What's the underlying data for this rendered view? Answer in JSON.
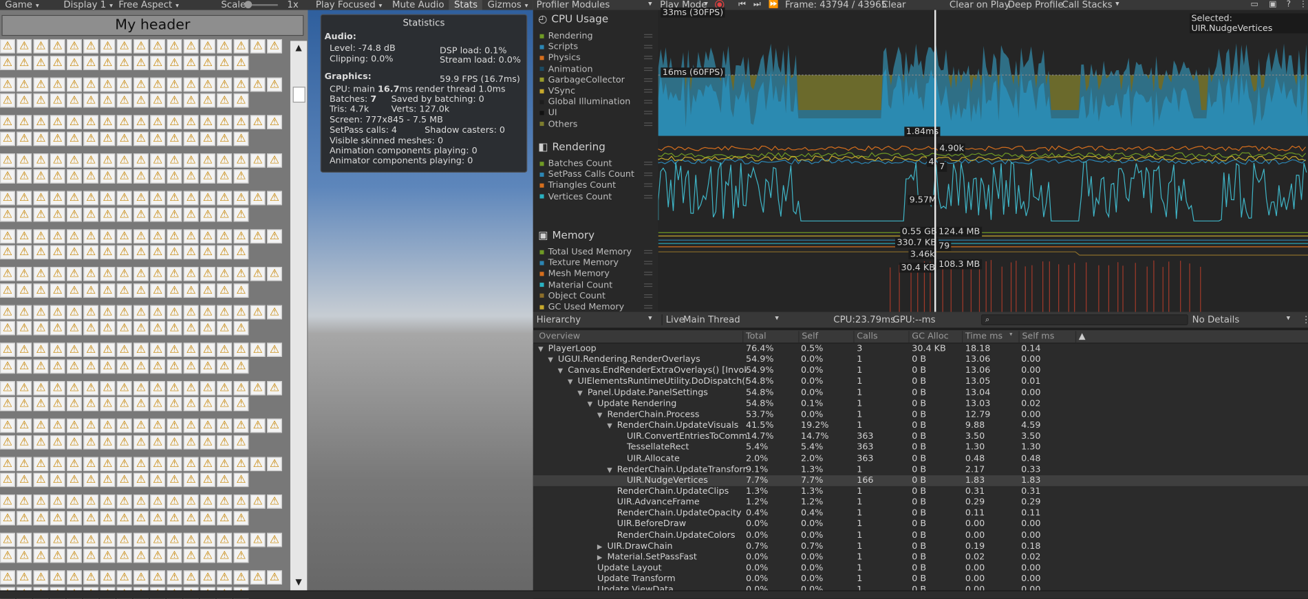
{
  "game_toolbar": {
    "tab": "Game",
    "display": "Display 1",
    "aspect": "Free Aspect",
    "scale_label": "Scale",
    "scale_value": "1x",
    "play_focused": "Play Focused",
    "mute": "Mute Audio",
    "stats": "Stats",
    "gizmos": "Gizmos"
  },
  "game_view": {
    "header": "My header"
  },
  "stats": {
    "title": "Statistics",
    "audio": "Audio:",
    "level": "Level: -74.8 dB",
    "clipping": "Clipping: 0.0%",
    "dsp": "DSP load: 0.1%",
    "stream": "Stream load: 0.0%",
    "graphics": "Graphics:",
    "fps": "59.9 FPS (16.7ms)",
    "cpu_prefix": "CPU: main ",
    "cpu_main": "16.7",
    "cpu_suffix": "ms  render thread 1.0ms",
    "batches_prefix": "Batches: ",
    "batches": "7",
    "saved": "Saved by batching: 0",
    "tris": "Tris: 4.7k",
    "verts": "Verts: 127.0k",
    "screen": "Screen: 777x845 - 7.5 MB",
    "setpass": "SetPass calls: 4",
    "shadow": "Shadow casters: 0",
    "skinned": "Visible skinned meshes: 0",
    "animation": "Animation components playing: 0",
    "animator": "Animator components playing: 0"
  },
  "profiler_toolbar": {
    "modules": "Profiler Modules",
    "play_mode": "Play Mode",
    "frame": "Frame: 43794 / 43965",
    "clear": "Clear",
    "clear_on_play": "Clear on Play",
    "deep": "Deep Profile",
    "call_stacks": "Call Stacks"
  },
  "modules": [
    {
      "title": "CPU Usage",
      "items": [
        [
          "Rendering",
          "#6f9a25"
        ],
        [
          "Scripts",
          "#2c86b4"
        ],
        [
          "Physics",
          "#d56e1d"
        ],
        [
          "Animation",
          "#1b4b63"
        ],
        [
          "GarbageCollector",
          "#999c2b"
        ],
        [
          "VSync",
          "#c7a92c"
        ],
        [
          "Global Illumination",
          "#1d1d1d"
        ],
        [
          "UI",
          "#111111"
        ],
        [
          "Others",
          "#7c7c2e"
        ]
      ]
    },
    {
      "title": "Rendering",
      "items": [
        [
          "Batches Count",
          "#6f9a25"
        ],
        [
          "SetPass Calls Count",
          "#2c86b4"
        ],
        [
          "Triangles Count",
          "#d56e1d"
        ],
        [
          "Vertices Count",
          "#2ab1c1"
        ]
      ]
    },
    {
      "title": "Memory",
      "items": [
        [
          "Total Used Memory",
          "#6f9a25"
        ],
        [
          "Texture Memory",
          "#2c86b4"
        ],
        [
          "Mesh Memory",
          "#d56e1d"
        ],
        [
          "Material Count",
          "#2ab1c1"
        ],
        [
          "Object Count",
          "#8c6e2a"
        ],
        [
          "GC Used Memory",
          "#c7a92c"
        ]
      ]
    }
  ],
  "chart_labels": {
    "fps30": "33ms (30FPS)",
    "fps60": "16ms (60FPS)",
    "selected": "Selected: UIR.NudgeVertices",
    "cpu_val": "1.84ms",
    "r1": "4.90k",
    "r2": "4",
    "r3": "7",
    "r4": "9.57M",
    "m1": "0.55 GB",
    "m2": "124.4 MB",
    "m3": "330.7 KB",
    "m4": "79",
    "m5": "3.46k",
    "m6": "30.4 KB",
    "m7": "108.3 MB"
  },
  "hierarchy_bar": {
    "view": "Hierarchy",
    "live": "Live",
    "thread": "Main Thread",
    "cpu": "CPU:23.79ms",
    "gpu": "GPU:--ms",
    "details": "No Details",
    "search_icon": "⌕"
  },
  "columns": [
    "Overview",
    "Total",
    "Self",
    "Calls",
    "GC Alloc",
    "Time ms",
    "Self ms"
  ],
  "rows": [
    {
      "d": 0,
      "e": "▼",
      "n": "PlayerLoop",
      "t": "76.4%",
      "s": "0.5%",
      "c": "3",
      "g": "30.4 KB",
      "tm": "18.18",
      "sm": "0.14"
    },
    {
      "d": 1,
      "e": "▼",
      "n": "UGUI.Rendering.RenderOverlays",
      "t": "54.9%",
      "s": "0.0%",
      "c": "1",
      "g": "0 B",
      "tm": "13.06",
      "sm": "0.00"
    },
    {
      "d": 2,
      "e": "▼",
      "n": "Canvas.EndRenderExtraOverlays() [Invoke]",
      "t": "54.9%",
      "s": "0.0%",
      "c": "1",
      "g": "0 B",
      "tm": "13.06",
      "sm": "0.00"
    },
    {
      "d": 3,
      "e": "▼",
      "n": "UIElementsRuntimeUtility.DoDispatch(Repai",
      "t": "54.8%",
      "s": "0.0%",
      "c": "1",
      "g": "0 B",
      "tm": "13.05",
      "sm": "0.01"
    },
    {
      "d": 4,
      "e": "▼",
      "n": "Panel.Update.PanelSettings",
      "t": "54.8%",
      "s": "0.0%",
      "c": "1",
      "g": "0 B",
      "tm": "13.04",
      "sm": "0.00"
    },
    {
      "d": 5,
      "e": "▼",
      "n": "Update Rendering",
      "t": "54.8%",
      "s": "0.1%",
      "c": "1",
      "g": "0 B",
      "tm": "13.03",
      "sm": "0.02"
    },
    {
      "d": 6,
      "e": "▼",
      "n": "RenderChain.Process",
      "t": "53.7%",
      "s": "0.0%",
      "c": "1",
      "g": "0 B",
      "tm": "12.79",
      "sm": "0.00"
    },
    {
      "d": 7,
      "e": "▼",
      "n": "RenderChain.UpdateVisuals",
      "t": "41.5%",
      "s": "19.2%",
      "c": "1",
      "g": "0 B",
      "tm": "9.88",
      "sm": "4.59"
    },
    {
      "d": 8,
      "e": "",
      "n": "UIR.ConvertEntriesToComman",
      "t": "14.7%",
      "s": "14.7%",
      "c": "363",
      "g": "0 B",
      "tm": "3.50",
      "sm": "3.50"
    },
    {
      "d": 8,
      "e": "",
      "n": "TessellateRect",
      "t": "5.4%",
      "s": "5.4%",
      "c": "363",
      "g": "0 B",
      "tm": "1.30",
      "sm": "1.30"
    },
    {
      "d": 8,
      "e": "",
      "n": "UIR.Allocate",
      "t": "2.0%",
      "s": "2.0%",
      "c": "363",
      "g": "0 B",
      "tm": "0.48",
      "sm": "0.48"
    },
    {
      "d": 7,
      "e": "▼",
      "n": "RenderChain.UpdateTransforms",
      "t": "9.1%",
      "s": "1.3%",
      "c": "1",
      "g": "0 B",
      "tm": "2.17",
      "sm": "0.33"
    },
    {
      "d": 8,
      "e": "",
      "n": "UIR.NudgeVertices",
      "t": "7.7%",
      "s": "7.7%",
      "c": "166",
      "g": "0 B",
      "tm": "1.83",
      "sm": "1.83",
      "sel": true
    },
    {
      "d": 7,
      "e": "",
      "n": "RenderChain.UpdateClips",
      "t": "1.3%",
      "s": "1.3%",
      "c": "1",
      "g": "0 B",
      "tm": "0.31",
      "sm": "0.31"
    },
    {
      "d": 7,
      "e": "",
      "n": "UIR.AdvanceFrame",
      "t": "1.2%",
      "s": "1.2%",
      "c": "1",
      "g": "0 B",
      "tm": "0.29",
      "sm": "0.29"
    },
    {
      "d": 7,
      "e": "",
      "n": "RenderChain.UpdateOpacity",
      "t": "0.4%",
      "s": "0.4%",
      "c": "1",
      "g": "0 B",
      "tm": "0.11",
      "sm": "0.11"
    },
    {
      "d": 7,
      "e": "",
      "n": "UIR.BeforeDraw",
      "t": "0.0%",
      "s": "0.0%",
      "c": "1",
      "g": "0 B",
      "tm": "0.00",
      "sm": "0.00"
    },
    {
      "d": 7,
      "e": "",
      "n": "RenderChain.UpdateColors",
      "t": "0.0%",
      "s": "0.0%",
      "c": "1",
      "g": "0 B",
      "tm": "0.00",
      "sm": "0.00"
    },
    {
      "d": 6,
      "e": "▶",
      "n": "UIR.DrawChain",
      "t": "0.7%",
      "s": "0.7%",
      "c": "1",
      "g": "0 B",
      "tm": "0.19",
      "sm": "0.18"
    },
    {
      "d": 6,
      "e": "▶",
      "n": "Material.SetPassFast",
      "t": "0.0%",
      "s": "0.0%",
      "c": "1",
      "g": "0 B",
      "tm": "0.02",
      "sm": "0.02"
    },
    {
      "d": 5,
      "e": "",
      "n": "Update Layout",
      "t": "0.0%",
      "s": "0.0%",
      "c": "1",
      "g": "0 B",
      "tm": "0.00",
      "sm": "0.00"
    },
    {
      "d": 5,
      "e": "",
      "n": "Update Transform",
      "t": "0.0%",
      "s": "0.0%",
      "c": "1",
      "g": "0 B",
      "tm": "0.00",
      "sm": "0.00"
    },
    {
      "d": 5,
      "e": "",
      "n": "Update ViewData",
      "t": "0.0%",
      "s": "0.0%",
      "c": "1",
      "g": "0 B",
      "tm": "0.00",
      "sm": "0.00"
    }
  ]
}
